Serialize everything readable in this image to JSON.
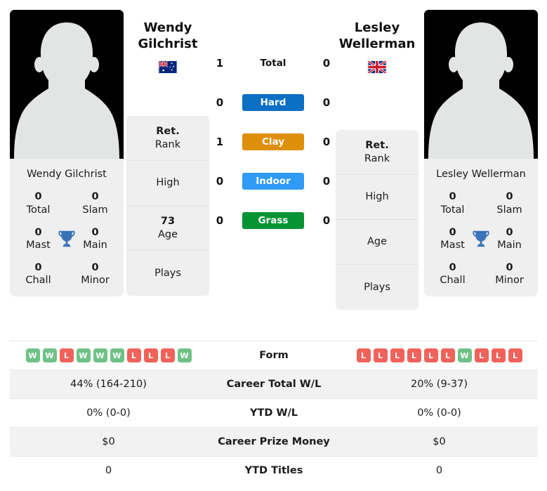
{
  "players": {
    "left": {
      "first_name": "Wendy",
      "last_name": "Gilchrist",
      "full_name": "Wendy Gilchrist",
      "flag": "australia-flag",
      "titles": {
        "total_value": "0",
        "total_label": "Total",
        "slam_value": "0",
        "slam_label": "Slam",
        "mast_value": "0",
        "mast_label": "Mast",
        "main_value": "0",
        "main_label": "Main",
        "chall_value": "0",
        "chall_label": "Chall",
        "minor_value": "0",
        "minor_label": "Minor",
        "trophy_icon": "trophy-icon"
      },
      "info": [
        {
          "value": "Ret.",
          "label": "Rank"
        },
        {
          "value": "",
          "label": "High"
        },
        {
          "value": "73",
          "label": "Age"
        },
        {
          "value": "",
          "label": "Plays"
        }
      ],
      "form": [
        "W",
        "W",
        "L",
        "W",
        "W",
        "W",
        "L",
        "L",
        "L",
        "W"
      ]
    },
    "right": {
      "first_name": "Lesley",
      "last_name": "Wellerman",
      "full_name": "Lesley Wellerman",
      "flag": "united-kingdom-flag",
      "titles": {
        "total_value": "0",
        "total_label": "Total",
        "slam_value": "0",
        "slam_label": "Slam",
        "mast_value": "0",
        "mast_label": "Mast",
        "main_value": "0",
        "main_label": "Main",
        "chall_value": "0",
        "chall_label": "Chall",
        "minor_value": "0",
        "minor_label": "Minor",
        "trophy_icon": "trophy-icon"
      },
      "info": [
        {
          "value": "Ret.",
          "label": "Rank"
        },
        {
          "value": "",
          "label": "High"
        },
        {
          "value": "",
          "label": "Age"
        },
        {
          "value": "",
          "label": "Plays"
        }
      ],
      "form": [
        "L",
        "L",
        "L",
        "L",
        "L",
        "L",
        "W",
        "L",
        "L",
        "L"
      ]
    }
  },
  "head_to_head": [
    {
      "label": "Total",
      "left": "1",
      "right": "0",
      "color": "",
      "plain": true
    },
    {
      "label": "Hard",
      "left": "0",
      "right": "0",
      "color": "#0b6fc4",
      "plain": false
    },
    {
      "label": "Clay",
      "left": "1",
      "right": "0",
      "color": "#de8f0a",
      "plain": false
    },
    {
      "label": "Indoor",
      "left": "0",
      "right": "0",
      "color": "#2f9bf5",
      "plain": false
    },
    {
      "label": "Grass",
      "left": "0",
      "right": "0",
      "color": "#049433",
      "plain": false
    }
  ],
  "comparison_rows": [
    {
      "label": "Form",
      "left": "",
      "right": "",
      "type": "form",
      "shaded": false
    },
    {
      "label": "Career Total W/L",
      "left": "44% (164-210)",
      "right": "20% (9-37)",
      "type": "text",
      "shaded": true
    },
    {
      "label": "YTD W/L",
      "left": "0% (0-0)",
      "right": "0% (0-0)",
      "type": "text",
      "shaded": false
    },
    {
      "label": "Career Prize Money",
      "left": "$0",
      "right": "$0",
      "type": "text",
      "shaded": true
    },
    {
      "label": "YTD Titles",
      "left": "0",
      "right": "0",
      "type": "text",
      "shaded": false
    }
  ],
  "colors": {
    "win_badge": "#6fc286",
    "loss_badge": "#f0625a",
    "card_bg": "#efefef",
    "trophy": "#3a73b8"
  }
}
